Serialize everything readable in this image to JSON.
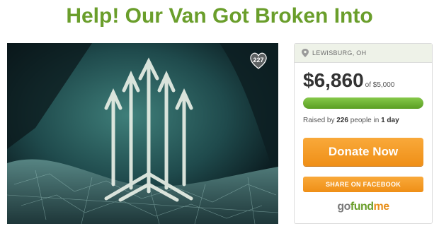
{
  "page": {
    "title": "Help! Our Van Got Broken Into"
  },
  "photo": {
    "heart_count": "227",
    "heart_icon": "heart-icon"
  },
  "campaign": {
    "location": "LEWISBURG, OH",
    "location_icon": "map-pin-icon",
    "amount_raised": "$6,860",
    "goal_text": "of $5,000",
    "progress_fraction": 1.0,
    "raised_prefix": "Raised by ",
    "people_count": "226",
    "raised_middle": " people in ",
    "duration": "1 day",
    "donate_label": "Donate Now",
    "share_label": "SHARE ON FACEBOOK"
  },
  "brand": {
    "logo_part1": "go",
    "logo_part2": "fund",
    "logo_part3": "me",
    "colors": {
      "title_green": "#6a9e2b",
      "progress_green": "#6ab336",
      "button_orange": "#f39c1f"
    }
  }
}
